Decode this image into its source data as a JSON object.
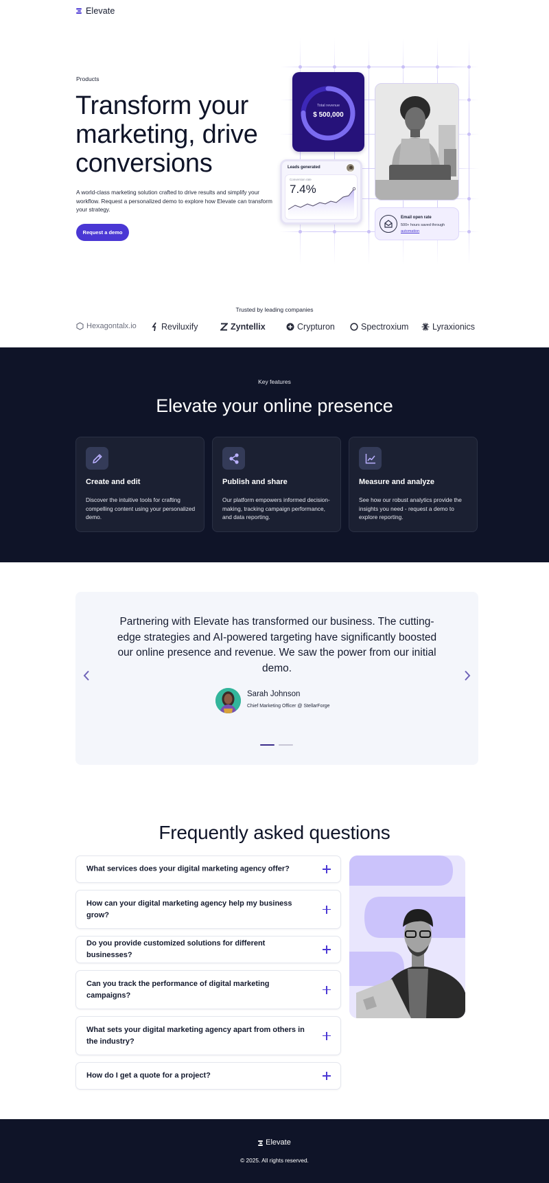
{
  "header": {
    "logo_text": "Elevate"
  },
  "hero": {
    "eyebrow": "Products",
    "title": "Transform your marketing, drive conversions",
    "description": "A world-class marketing solution crafted to drive results and simplify your workflow. Request a personalized demo to explore how Elevate can transform your strategy.",
    "cta_label": "Request a demo",
    "revenue": {
      "label": "Total revenue",
      "value": "$ 500,000"
    },
    "leads": {
      "title": "Leads generated",
      "subtitle": "Conversion rate",
      "value": "7.4%"
    },
    "email": {
      "title": "Email open rate",
      "description": "500+ hours saved through",
      "link": "automation"
    }
  },
  "trusted": {
    "title": "Trusted by leading companies",
    "companies": [
      "Hexagontalx.io",
      "Reviluxify",
      "Zyntellix",
      "Crypturon",
      "Spectroxium",
      "Lyraxionics"
    ]
  },
  "features": {
    "eyebrow": "Key features",
    "title": "Elevate your online presence",
    "cards": [
      {
        "icon": "pencil-icon",
        "title": "Create and edit",
        "description": "Discover the intuitive tools for crafting compelling content using your personalized demo."
      },
      {
        "icon": "share-icon",
        "title": "Publish and share",
        "description": "Our platform empowers informed decision-making, tracking campaign performance, and data reporting."
      },
      {
        "icon": "chart-line-icon",
        "title": "Measure and analyze",
        "description": "See how our robust analytics provide the insights you need - request a demo to explore reporting."
      }
    ]
  },
  "testimonial": {
    "quote": "Partnering with Elevate has transformed our business. The cutting-edge strategies and AI-powered targeting have significantly boosted our online presence and revenue. We saw the power from our initial demo.",
    "name": "Sarah Johnson",
    "role": "Chief Marketing Officer @ StellarForge"
  },
  "faq": {
    "title": "Frequently asked questions",
    "items": [
      "What services does your digital marketing agency offer?",
      "How can your digital marketing agency help my business grow?",
      "Do you provide customized solutions for different businesses?",
      "Can you track the performance of digital marketing campaigns?",
      "What sets your digital marketing agency apart from others in the industry?",
      "How do I get a quote for a project?"
    ]
  },
  "footer": {
    "logo_text": "Elevate",
    "copyright": "© 2025. All rights reserved."
  },
  "colors": {
    "accent": "#4a37d4",
    "dark": "#0f1428",
    "card_dark": "#1b2032",
    "testimonial_bg": "#f4f6fb",
    "lavender": "#c9c0f6"
  }
}
